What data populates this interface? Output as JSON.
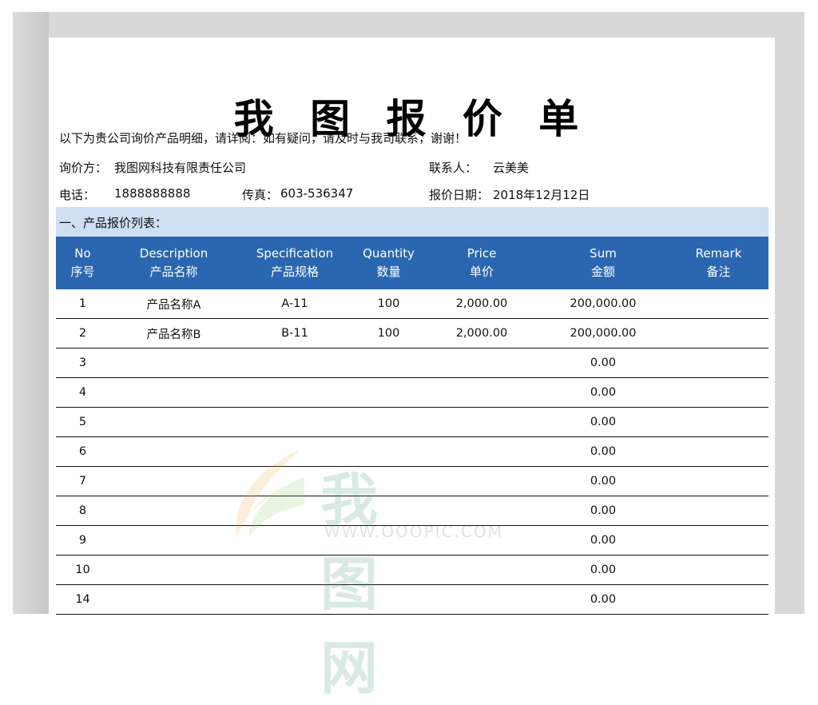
{
  "document": {
    "title": "我 图 报 价 单",
    "intro": "以下为贵公司询价产品明细，请详阅：如有疑问，请及时与我司联系，谢谢！",
    "inquirer_label": "询价方：",
    "inquirer_value": "我图网科技有限责任公司",
    "contact_label": "联系人：",
    "contact_value": "云美美",
    "phone_label": "电话：",
    "phone_value": "1888888888",
    "fax_label": "传真：",
    "fax_value": "603-536347",
    "date_label": "报价日期：",
    "date_value": "2018年12月12日",
    "section_title": "一、产品报价列表："
  },
  "table": {
    "headers": [
      {
        "en": "No",
        "zh": "序号"
      },
      {
        "en": "Description",
        "zh": "产品名称"
      },
      {
        "en": "Specification",
        "zh": "产品规格"
      },
      {
        "en": "Quantity",
        "zh": "数量"
      },
      {
        "en": "Price",
        "zh": "单价"
      },
      {
        "en": "Sum",
        "zh": "金额"
      },
      {
        "en": "Remark",
        "zh": "备注"
      }
    ],
    "rows": [
      [
        "1",
        "产品名称A",
        "A-11",
        "100",
        "2,000.00",
        "200,000.00",
        ""
      ],
      [
        "2",
        "产品名称B",
        "B-11",
        "100",
        "2,000.00",
        "200,000.00",
        ""
      ],
      [
        "3",
        "",
        "",
        "",
        "",
        "0.00",
        ""
      ],
      [
        "4",
        "",
        "",
        "",
        "",
        "0.00",
        ""
      ],
      [
        "5",
        "",
        "",
        "",
        "",
        "0.00",
        ""
      ],
      [
        "6",
        "",
        "",
        "",
        "",
        "0.00",
        ""
      ],
      [
        "7",
        "",
        "",
        "",
        "",
        "0.00",
        ""
      ],
      [
        "8",
        "",
        "",
        "",
        "",
        "0.00",
        ""
      ],
      [
        "9",
        "",
        "",
        "",
        "",
        "0.00",
        ""
      ],
      [
        "10",
        "",
        "",
        "",
        "",
        "0.00",
        ""
      ],
      [
        "14",
        "",
        "",
        "",
        "",
        "0.00",
        ""
      ]
    ]
  },
  "watermark": {
    "text": "我图网",
    "url": "WWW.OOOPIC.COM"
  },
  "colors": {
    "header_bg": "#2b67b0",
    "section_bg": "#cfdff3",
    "frame": "#d9d8d8"
  }
}
